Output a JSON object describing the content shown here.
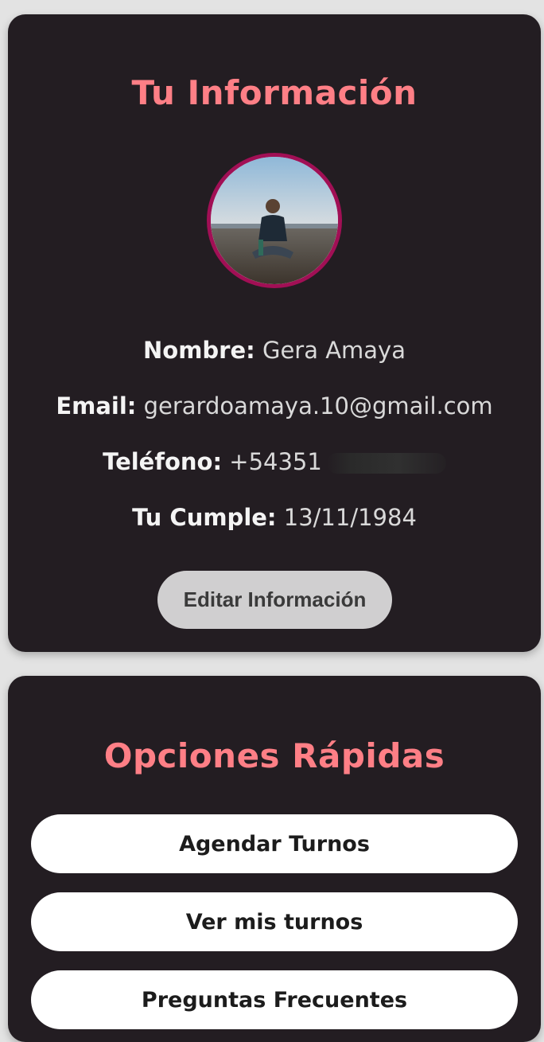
{
  "profile": {
    "title": "Tu Información",
    "name_label": "Nombre:",
    "name_value": "Gera Amaya",
    "email_label": "Email:",
    "email_value": "gerardoamaya.10@gmail.com",
    "phone_label": "Teléfono:",
    "phone_value": "+54351",
    "birthday_label": "Tu Cumple:",
    "birthday_value": "13/11/1984",
    "edit_button": "Editar Información"
  },
  "quick_options": {
    "title": "Opciones Rápidas",
    "items": [
      {
        "label": "Agendar Turnos"
      },
      {
        "label": "Ver mis turnos"
      },
      {
        "label": "Preguntas Frecuentes"
      }
    ]
  },
  "colors": {
    "background": "#e3e3e3",
    "card": "#231d22",
    "title_accent": "#ff7f86",
    "avatar_border": "#a10f55",
    "edit_button_bg": "#d0cfd0",
    "quick_button_bg": "#ffffff"
  }
}
